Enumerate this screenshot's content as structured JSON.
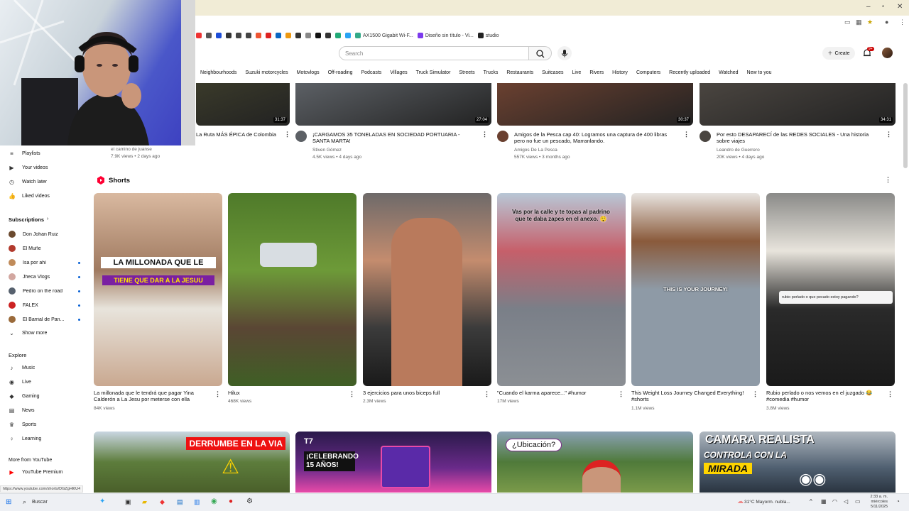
{
  "browser": {
    "bookmarks": [
      "AX1500 Gigabit Wi-F...",
      "Diseño sin título - Vi...",
      "studio"
    ],
    "search_placeholder": "Search",
    "create_label": "Create",
    "notif_badge": "9+"
  },
  "chips": [
    "Neighbourhoods",
    "Suzuki motorcycles",
    "Motovlogs",
    "Off-roading",
    "Podcasts",
    "Villages",
    "Truck Simulator",
    "Streets",
    "Trucks",
    "Restaurants",
    "Suitcases",
    "Live",
    "Rivers",
    "History",
    "Computers",
    "Recently uploaded",
    "Watched",
    "New to you"
  ],
  "sidebar": {
    "you_items": [
      {
        "label": "Playlists",
        "icon": "playlist-icon"
      },
      {
        "label": "Your videos",
        "icon": "your-videos-icon"
      },
      {
        "label": "Watch later",
        "icon": "clock-icon"
      },
      {
        "label": "Liked videos",
        "icon": "thumbs-up-icon"
      }
    ],
    "subscriptions_title": "Subscriptions",
    "subscriptions": [
      {
        "label": "Don Johan Ruiz",
        "dot": false,
        "color": "#6b4a2f"
      },
      {
        "label": "El Muñe",
        "dot": false,
        "color": "#b23a2d"
      },
      {
        "label": "Isa por ahí",
        "dot": true,
        "color": "#c08b5a"
      },
      {
        "label": "Jheca Vlogs",
        "dot": true,
        "color": "#d2a7a0"
      },
      {
        "label": "Pedro on the road",
        "dot": true,
        "color": "#57616e"
      },
      {
        "label": "FALEX",
        "dot": true,
        "color": "#cc2222"
      },
      {
        "label": "El Barrial de Pan...",
        "dot": true,
        "color": "#9a6a3a"
      }
    ],
    "show_more": "Show more",
    "explore_title": "Explore",
    "explore": [
      {
        "label": "Music",
        "icon": "music-icon"
      },
      {
        "label": "Live",
        "icon": "live-icon"
      },
      {
        "label": "Gaming",
        "icon": "gaming-icon"
      },
      {
        "label": "News",
        "icon": "news-icon"
      },
      {
        "label": "Sports",
        "icon": "trophy-icon"
      },
      {
        "label": "Learning",
        "icon": "bulb-icon"
      }
    ],
    "more_title": "More from YouTube",
    "premium": "YouTube Premium"
  },
  "top_videos": [
    {
      "title": "La Ruta MÁS ÉPICA de Colombia",
      "channel": "el camino de juanse",
      "meta": "7.9K views • 2 days ago",
      "duration": "31:37",
      "color": "#3a3a2a"
    },
    {
      "title": "¡CARGAMOS 35 TONELADAS EN SOCIEDAD PORTUARIA - SANTA MARTA!",
      "channel": "Stiven Gómez",
      "meta": "4.5K views • 4 days ago",
      "duration": "27:04",
      "color": "#5c6065"
    },
    {
      "title": "Amigos de la Pesca cap 40: Logramos una captura de 400 libras pero no fue un pescado, Marranlando.",
      "channel": "Amigos De La Pesca",
      "meta": "557K views • 3 months ago",
      "duration": "30:37",
      "color": "#6a4030"
    },
    {
      "title": "Por esto DESAPARECÍ de las REDES SOCIALES - Una historia sobre viajes",
      "channel": "Leandro de Guerrero",
      "meta": "20K views • 4 days ago",
      "duration": "34:31",
      "color": "#4a4540"
    }
  ],
  "shorts_title": "Shorts",
  "shorts": [
    {
      "title": "La millonada que le tendrá que pagar Yina Calderón a La Jesu por meterse con ella",
      "views": "84K views",
      "overlay1": "LA MILLONADA QUE LE",
      "overlay2": "TIENE QUE DAR A LA JESUU"
    },
    {
      "title": "Hilux",
      "views": "468K views"
    },
    {
      "title": "3 ejercicios para unos biceps full",
      "views": "2.3M views"
    },
    {
      "title": "\"Cuando el karma aparece...\" #humor",
      "views": "17M views",
      "overlay1": "Vas por la calle y te topas al padrino que te daba zapes en el anexo. 😲"
    },
    {
      "title": "This Weight Loss Journey Changed Everything! #shorts",
      "views": "1.1M views",
      "overlay1": "THIS IS YOUR JOURNEY!"
    },
    {
      "title": "Rubio perlado o nos vemos en el juzgado 😂 #comedia #humor",
      "views": "3.8M views",
      "overlay1": "rubio perlado o que pecado estoy pagando?"
    }
  ],
  "bottom_videos": [
    {
      "overlay": "DERRUMBE EN LA VIA"
    },
    {
      "overlay": "¡CELEBRANDO 15 AÑOS!"
    },
    {
      "overlay": "¿Ubicación?"
    },
    {
      "overlay": "CAMARA REALISTA",
      "overlay2": "CONTROLA CON LA",
      "overlay3": "MIRADA"
    }
  ],
  "status_url": "https://www.youtube.com/shorts/DGZgHl6U4",
  "taskbar": {
    "search": "Buscar",
    "weather": "31°C  Mayorm. nubla...",
    "time": "2:33 a. m.",
    "day": "miércoles",
    "date": "5/11/2025"
  }
}
